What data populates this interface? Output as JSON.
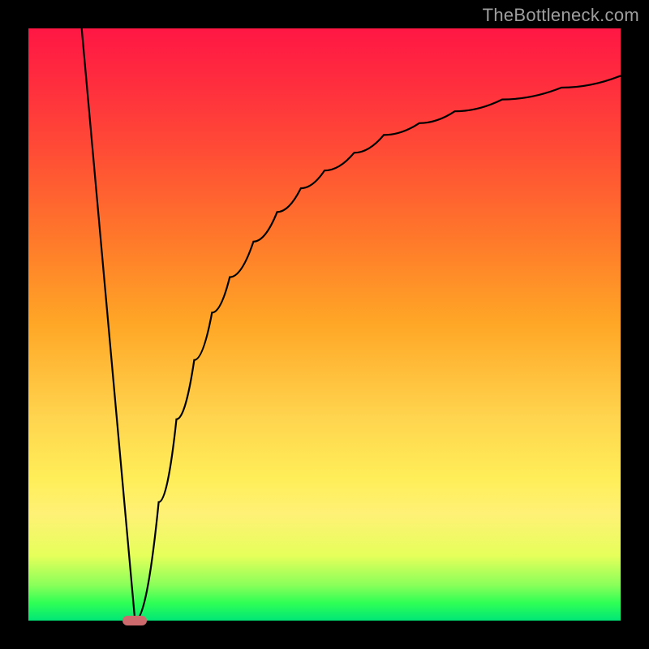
{
  "watermark": "TheBottleneck.com",
  "colors": {
    "frame_bg": "#000000",
    "gradient_top": "#ff1744",
    "gradient_mid1": "#ffa726",
    "gradient_mid2": "#ffee58",
    "gradient_bottom": "#00e676",
    "curve_stroke": "#000000",
    "marker_fill": "#cc6a6e",
    "watermark_color": "#9e9e9e"
  },
  "chart_data": {
    "type": "line",
    "title": "",
    "xlabel": "",
    "ylabel": "",
    "xlim": [
      0,
      100
    ],
    "ylim": [
      0,
      100
    ],
    "grid": false,
    "legend": false,
    "annotations": [
      "TheBottleneck.com"
    ],
    "marker": {
      "x": 18,
      "y": 0
    },
    "series": [
      {
        "name": "left-line",
        "x": [
          9,
          18
        ],
        "y": [
          100,
          0
        ]
      },
      {
        "name": "right-curve",
        "x": [
          18,
          22,
          25,
          28,
          31,
          34,
          38,
          42,
          46,
          50,
          55,
          60,
          66,
          72,
          80,
          90,
          100
        ],
        "y": [
          0,
          20,
          34,
          44,
          52,
          58,
          64,
          69,
          73,
          76,
          79,
          82,
          84,
          86,
          88,
          90,
          92
        ]
      }
    ]
  }
}
